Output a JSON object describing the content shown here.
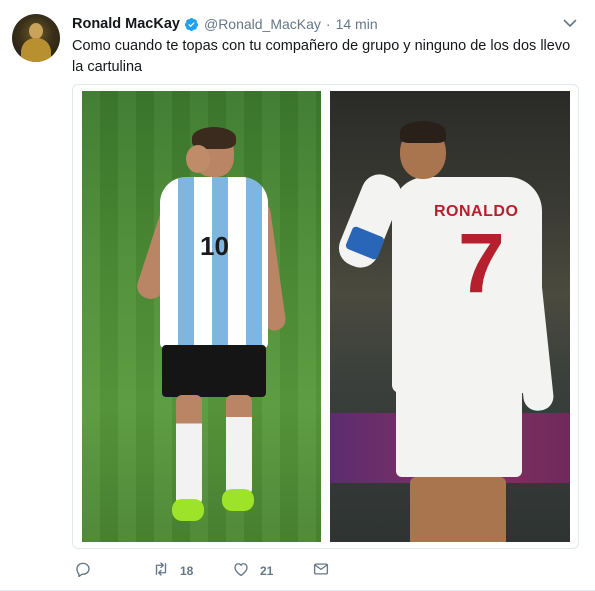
{
  "tweet": {
    "author_name": "Ronald MacKay",
    "handle": "@Ronald_MacKay",
    "separator": "·",
    "time": "14 min",
    "text": "Como cuando te topas con tu compañero de grupo y ninguno de los dos llevo la cartulina"
  },
  "media": {
    "left_photo": {
      "shirt_number": "10"
    },
    "right_photo": {
      "shirt_name": "RONALDO",
      "shirt_number": "7"
    }
  },
  "actions": {
    "reply_icon": "reply-icon",
    "retweet_icon": "retweet-icon",
    "retweet_count": "18",
    "like_icon": "heart-icon",
    "like_count": "21",
    "dm_icon": "envelope-icon"
  },
  "colors": {
    "verified_blue": "#1da1f2",
    "secondary_text": "#657786",
    "primary_text": "#14171a"
  }
}
